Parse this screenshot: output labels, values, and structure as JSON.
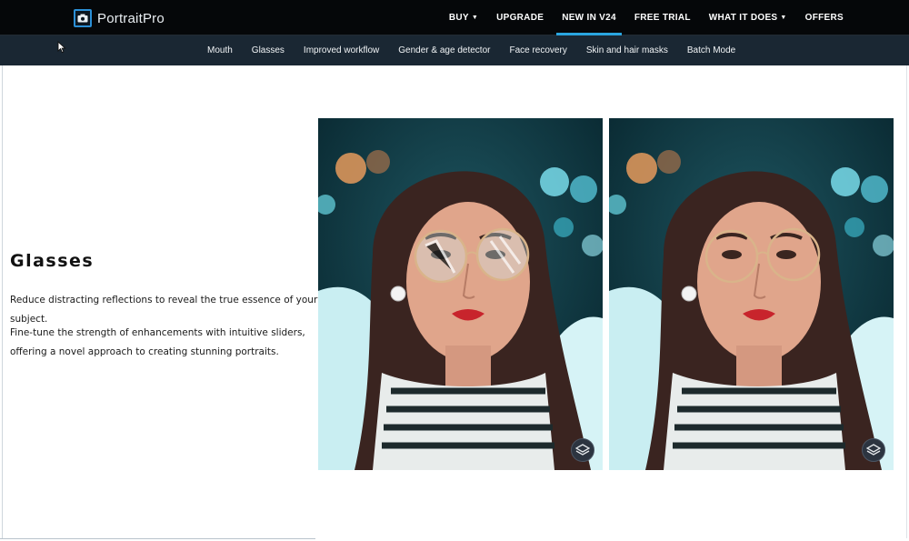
{
  "brand": {
    "name": "PortraitPro"
  },
  "top_nav": [
    {
      "label": "BUY",
      "dropdown": true,
      "active": false
    },
    {
      "label": "UPGRADE",
      "dropdown": false,
      "active": false
    },
    {
      "label": "NEW IN V24",
      "dropdown": false,
      "active": true
    },
    {
      "label": "FREE TRIAL",
      "dropdown": false,
      "active": false
    },
    {
      "label": "WHAT IT DOES",
      "dropdown": true,
      "active": false
    },
    {
      "label": "OFFERS",
      "dropdown": false,
      "active": false
    }
  ],
  "sub_nav": [
    "Mouth",
    "Glasses",
    "Improved workflow",
    "Gender & age detector",
    "Face recovery",
    "Skin and hair masks",
    "Batch Mode"
  ],
  "section": {
    "title": "Glasses",
    "paragraph_1": "Reduce distracting reflections to reveal the true essence of your subject.",
    "paragraph_2": "Fine-tune the strength of enhancements with intuitive sliders, offering a novel approach to creating stunning portraits."
  },
  "images": {
    "before": {
      "icon": "layers-icon"
    },
    "after": {
      "icon": "layers-icon"
    }
  },
  "colors": {
    "top_bar": "#050709",
    "sub_bar": "#1a2733",
    "accent": "#2aa5e0"
  }
}
